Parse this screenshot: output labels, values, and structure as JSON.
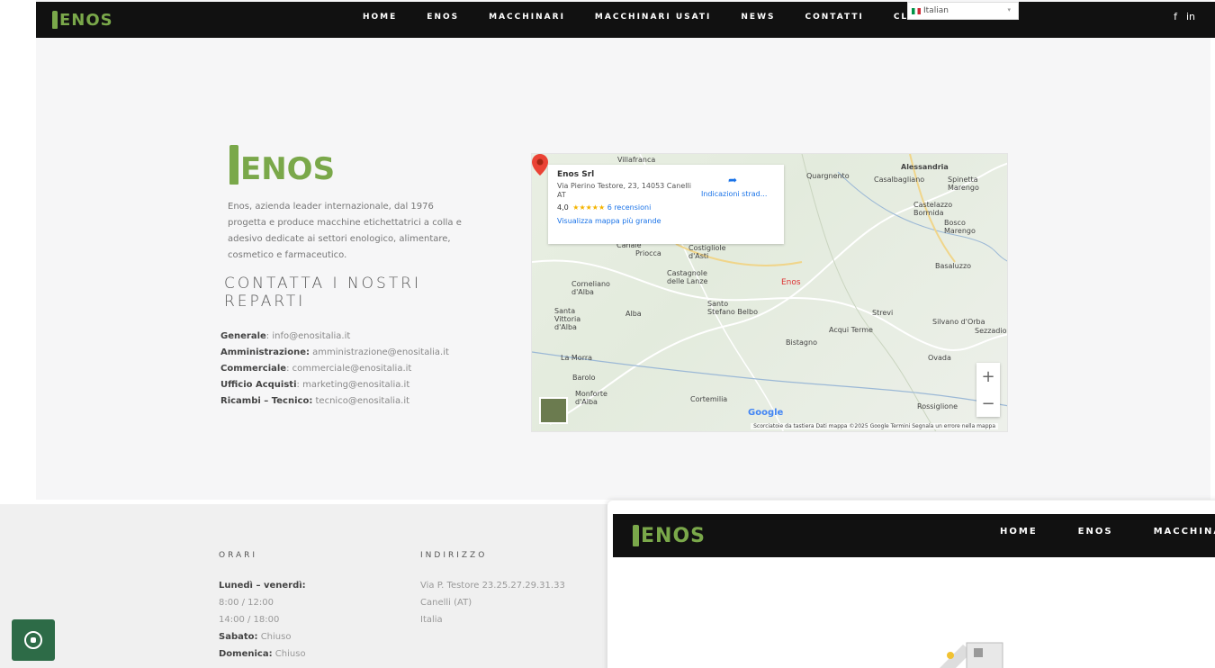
{
  "brand": {
    "logo_text": "ENOS"
  },
  "nav": {
    "items": [
      "HOME",
      "ENOS",
      "MACCHINARI",
      "MACCHINARI USATI",
      "NEWS",
      "CONTATTI",
      "CLIENTI"
    ],
    "language": "Italian",
    "social": [
      "f",
      "in"
    ]
  },
  "contact": {
    "intro": "Enos, azienda leader internazionale, dal 1976 progetta e produce macchine etichettatrici a colla e adesivo dedicate ai settori enologico, alimentare, cosmetico e farmaceutico.",
    "title": "CONTATTA I NOSTRI REPARTI",
    "lines": [
      {
        "label": "Generale",
        "value": "info@enositalia.it"
      },
      {
        "label": "Amministrazione:",
        "value": "amministrazione@enositalia.it"
      },
      {
        "label": "Commerciale",
        "value": "commerciale@enositalia.it"
      },
      {
        "label": "Ufficio Acquisti",
        "value": "marketing@enositalia.it"
      },
      {
        "label": "Ricambi – Tecnico:",
        "value": "tecnico@enositalia.it"
      }
    ]
  },
  "map": {
    "place_name": "Enos Srl",
    "address": "Via Pierino Testore, 23, 14053 Canelli AT",
    "rating": "4,0",
    "stars": "★★★★★",
    "reviews": "6 recensioni",
    "directions": "Indicazioni strad...",
    "bigger_map": "Visualizza mappa più grande",
    "pin_label": "Enos",
    "zoom_in": "+",
    "zoom_out": "−",
    "google": "Google",
    "attribution": "Scorciatoie da tastiera   Dati mappa ©2025 Google   Termini   Segnala un errore nella mappa",
    "towns": [
      "Villafranca",
      "Quargnento",
      "Alessandria",
      "Casalbagliano",
      "Spinetta Marengo",
      "Castelazzo Bormida",
      "Bosco Marengo",
      "Canale",
      "Priocca",
      "Costigliole d'Asti",
      "Castagnole delle Lanze",
      "Corneliano d'Alba",
      "Santo Stefano Belbo",
      "Strevi",
      "Sezzadio",
      "Santa Vittoria d'Alba",
      "Alba",
      "Acqui Terme",
      "Bistagno",
      "Silvano d'Orba",
      "Basaluzzo",
      "La Morra",
      "Barolo",
      "Monforte d'Alba",
      "Ovada",
      "Cortemilia",
      "Rossiglione"
    ]
  },
  "footer": {
    "hours_title": "ORARI",
    "hours": [
      {
        "label": "Lunedì – venerdì:",
        "value": ""
      },
      {
        "label": "",
        "value": "8:00 / 12:00"
      },
      {
        "label": "",
        "value": "14:00 / 18:00"
      },
      {
        "label": "Sabato:",
        "value": "Chiuso"
      },
      {
        "label": "Domenica:",
        "value": "Chiuso"
      }
    ],
    "address_title": "INDIRIZZO",
    "address": [
      "Via P. Testore 23.25.27.29.31.33",
      "Canelli (AT)",
      "Italia"
    ]
  },
  "overlay": {
    "logo_text": "ENOS",
    "nav": [
      "HOME",
      "ENOS",
      "MACCHINARI"
    ]
  },
  "colors": {
    "brand_green": "#7aa84a",
    "topbar": "#111111",
    "whatsapp": "#2d6b47"
  }
}
